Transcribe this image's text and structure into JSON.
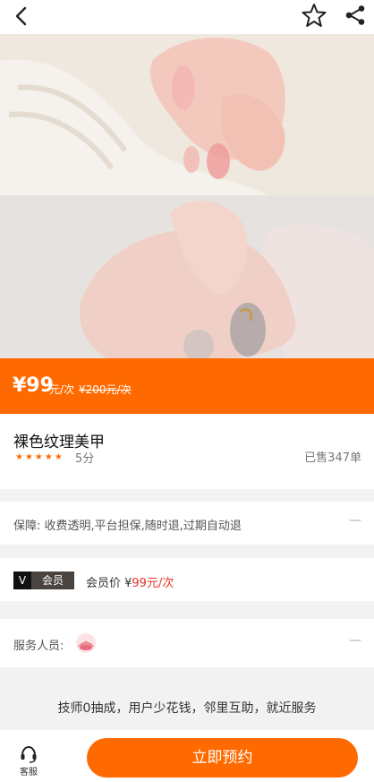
{
  "header": {
    "back_icon": "chevron-left-icon",
    "favorite_icon": "star-outline-icon",
    "share_icon": "share-icon"
  },
  "hero": {
    "images": [
      "nail-photo-top",
      "nail-photo-bottom"
    ]
  },
  "price": {
    "amount": "¥99",
    "unit": "元/次",
    "original": "¥200元/次",
    "bar_color": "#ff6a00"
  },
  "product": {
    "title": "裸色纹理美甲",
    "rating": 5,
    "rating_text": "5分",
    "sold": "已售347单"
  },
  "guarantee": {
    "text": "保障: 收费透明,平台担保,随时退,过期自动退",
    "expand": "—"
  },
  "member": {
    "badge_v": "V",
    "badge_label": "会员",
    "price_label": "会员价 ¥",
    "price_value": "99元/次",
    "price_color": "#e8322a"
  },
  "staff": {
    "label": "服务人员:",
    "expand": "—"
  },
  "footer": {
    "slogan": "技师0抽成，用户少花钱，邻里互助，就近服务",
    "customer_service_label": "客服",
    "book_label": "立即预约"
  }
}
